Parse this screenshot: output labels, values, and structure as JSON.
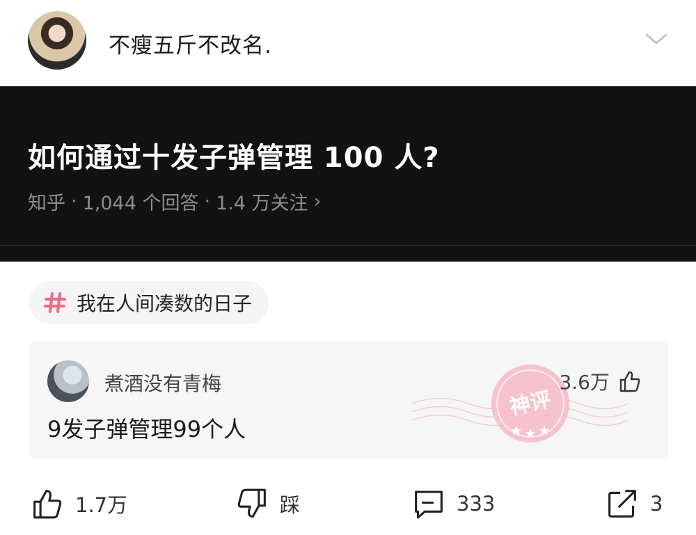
{
  "header": {
    "author_name": "不瘦五斤不改名.",
    "avatar_icon": "user-avatar",
    "menu_icon": "chevron-down-icon"
  },
  "question": {
    "title": "如何通过十发子弹管理 100 人?",
    "source": "知乎",
    "answers": "1,044 个回答",
    "followers": "1.4 万关注",
    "more": "›"
  },
  "topic": {
    "label": "我在人间凑数的日子",
    "icon": "hash-icon"
  },
  "hot_comment": {
    "author": "煮酒没有青梅",
    "text": "9发子弹管理99个人",
    "likes": "3.6万",
    "stamp": "神评"
  },
  "actions": {
    "like_count": "1.7万",
    "dislike_label": "踩",
    "comment_count": "333",
    "share_count": "3"
  },
  "colors": {
    "banner_bg": "#121212",
    "accent_pink": "#f06a8c",
    "card_bg": "#f6f6f6"
  }
}
